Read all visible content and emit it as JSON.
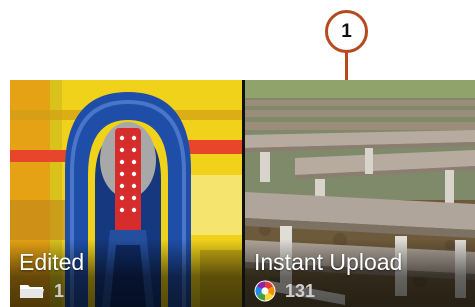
{
  "callout": {
    "number": "1"
  },
  "albums": [
    {
      "title": "Edited",
      "count": "1",
      "icon": "folder-icon"
    },
    {
      "title": "Instant Upload",
      "count": "131",
      "icon": "picasa-icon"
    }
  ]
}
